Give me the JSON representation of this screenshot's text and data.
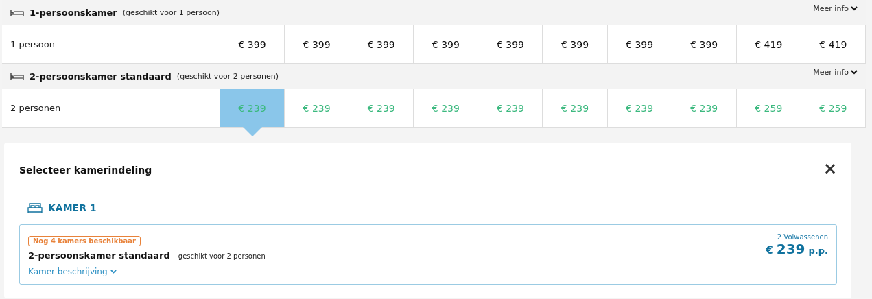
{
  "rooms": [
    {
      "name": "1-persoonskamer",
      "suitability": "(geschikt voor 1 persoon)",
      "more_info": "Meer info",
      "occupancy": "1 persoon",
      "kind": "standard",
      "prices": [
        {
          "text": "€ 399",
          "selected": false
        },
        {
          "text": "€ 399",
          "selected": false
        },
        {
          "text": "€ 399",
          "selected": false
        },
        {
          "text": "€ 399",
          "selected": false
        },
        {
          "text": "€ 399",
          "selected": false
        },
        {
          "text": "€ 399",
          "selected": false
        },
        {
          "text": "€ 399",
          "selected": false
        },
        {
          "text": "€ 399",
          "selected": false
        },
        {
          "text": "€ 419",
          "selected": false
        },
        {
          "text": "€ 419",
          "selected": false
        }
      ]
    },
    {
      "name": "2-persoonskamer standaard",
      "suitability": "(geschikt voor 2 personen)",
      "more_info": "Meer info",
      "occupancy": "2 personen",
      "kind": "available",
      "prices": [
        {
          "text": "€ 239",
          "selected": true
        },
        {
          "text": "€ 239",
          "selected": false
        },
        {
          "text": "€ 239",
          "selected": false
        },
        {
          "text": "€ 239",
          "selected": false
        },
        {
          "text": "€ 239",
          "selected": false
        },
        {
          "text": "€ 239",
          "selected": false
        },
        {
          "text": "€ 239",
          "selected": false
        },
        {
          "text": "€ 239",
          "selected": false
        },
        {
          "text": "€ 259",
          "selected": false
        },
        {
          "text": "€ 259",
          "selected": false
        }
      ]
    }
  ],
  "panel": {
    "title": "Selecteer kamerindeling",
    "close": "×",
    "room_heading": "KAMER 1",
    "option": {
      "badge": "Nog 4 kamers beschikbaar",
      "name": "2-persoonskamer standaard",
      "suitability": "geschikt voor 2 personen",
      "description_link": "Kamer beschrijving",
      "guests": "2 Volwassenen",
      "currency": "€",
      "amount": "239",
      "suffix": "p.p."
    }
  }
}
